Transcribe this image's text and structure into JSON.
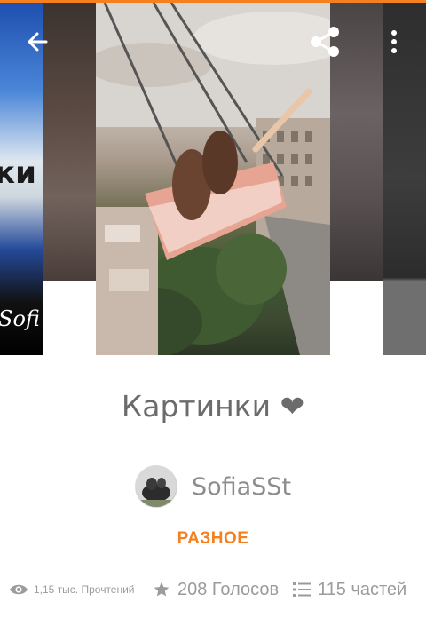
{
  "colors": {
    "accent": "#f4801f",
    "text_muted": "#9b9b9b",
    "title": "#6b6b6b"
  },
  "navigation": {
    "back_icon": "arrow-left-icon",
    "share_icon": "share-icon",
    "more_icon": "more-vertical-icon"
  },
  "story": {
    "title": "Картинки ❤",
    "author": "SofiaSSt",
    "category": "РАЗНОЕ"
  },
  "stats": {
    "reads": "1,15 тыс. Прочтений",
    "votes": "208 Голосов",
    "parts": "115 частей",
    "reads_icon": "eye-icon",
    "votes_icon": "star-icon",
    "parts_icon": "list-icon"
  },
  "covers": {
    "left_text": "ки",
    "left_signature": "Sofi"
  }
}
